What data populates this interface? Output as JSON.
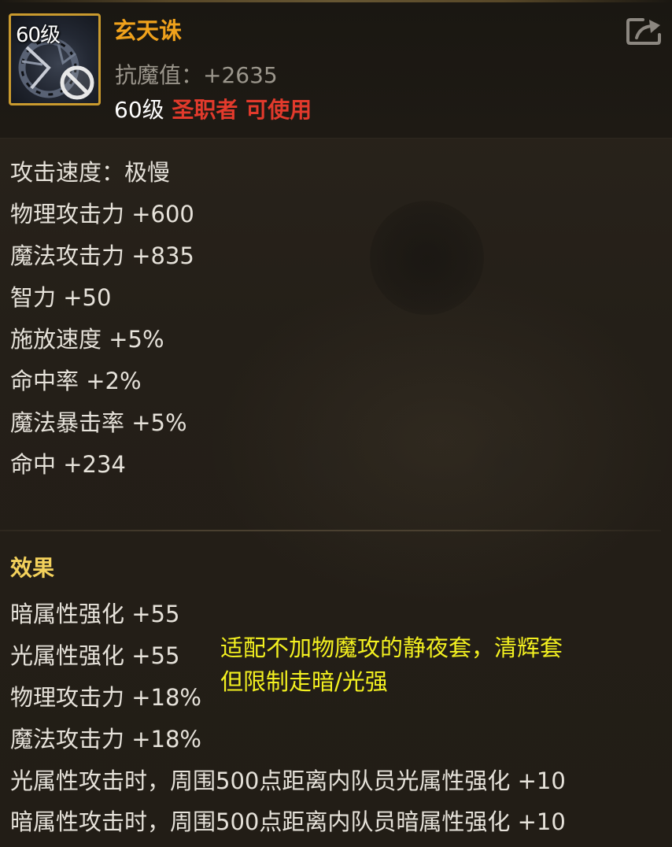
{
  "item": {
    "level_badge": "60级",
    "name": "玄天诛",
    "resist_label": "抗魔值：+2635",
    "requirement": {
      "level": "60级",
      "class_label": "圣职者",
      "usable_label": "可使用"
    }
  },
  "stats": [
    "攻击速度：极慢",
    "物理攻击力 +600",
    "魔法攻击力 +835",
    "智力 +50",
    "施放速度 +5%",
    "命中率 +2%",
    "魔法暴击率 +5%",
    "命中 +234"
  ],
  "effects": {
    "title": "效果",
    "lines": [
      "暗属性强化 +55",
      "光属性强化 +55",
      "物理攻击力 +18%",
      "魔法攻击力 +18%",
      "光属性攻击时，周围500点距离内队员光属性强化 +10",
      "暗属性攻击时，周围500点距离内队员暗属性强化 +10"
    ]
  },
  "annotation": {
    "line1": "适配不加物魔攻的静夜套，清辉套",
    "line2": "但限制走暗/光强"
  },
  "icons": {
    "share": "share-icon",
    "item": "dark-ring-icon",
    "forbidden": "forbidden-icon"
  },
  "colors": {
    "item_name": "#f0a21c",
    "class_requirement": "#e23a2c",
    "section_title": "#f3d15c",
    "annotation": "#f3f020",
    "icon_border": "#c99a2e"
  }
}
